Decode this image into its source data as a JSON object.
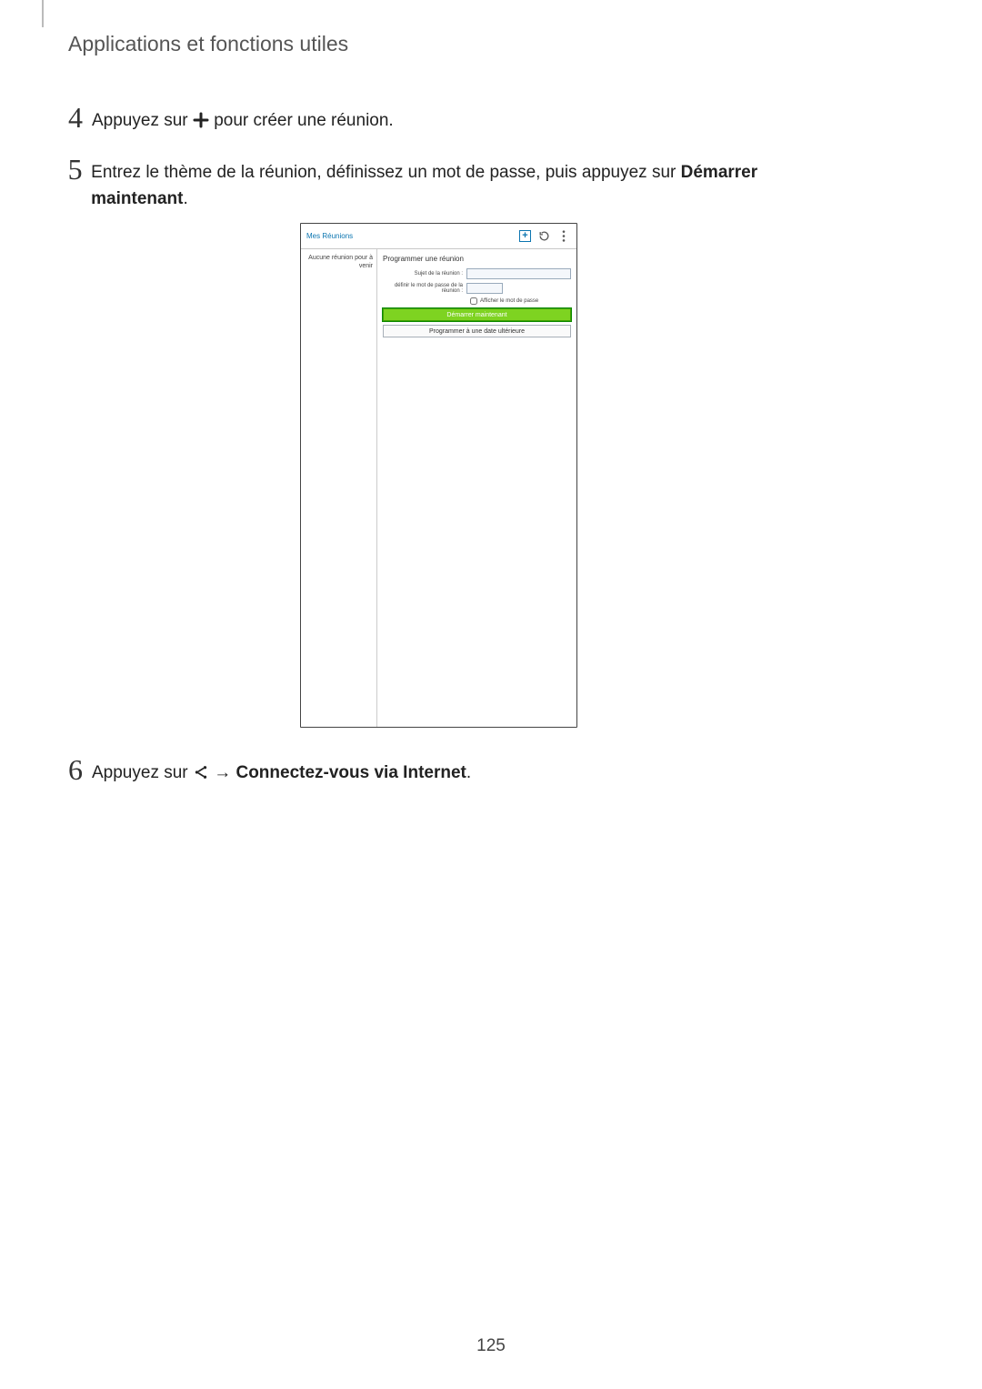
{
  "header": {
    "title": "Applications et fonctions utiles"
  },
  "steps": {
    "s4": {
      "num": "4",
      "prefix": "Appuyez sur ",
      "suffix": " pour créer une réunion."
    },
    "s5": {
      "num": "5",
      "text_a": "Entrez le thème de la réunion, définissez un mot de passe, puis appuyez sur ",
      "bold": "Démarrer maintenant",
      "text_b": "."
    },
    "s6": {
      "num": "6",
      "prefix": "Appuyez sur ",
      "arrow": " → ",
      "bold": "Connectez-vous via Internet",
      "suffix": "."
    }
  },
  "device": {
    "appbar_title": "Mes Réunions",
    "sidebar_text": "Aucune réunion pour à venir",
    "panel_title": "Programmer une réunion",
    "subject_label": "Sujet de la réunion :",
    "password_label": "définir le mot de passe de la réunion :",
    "show_password": "Afficher le mot de passe",
    "btn_start": "Démarrer maintenant",
    "btn_schedule": "Programmer à une date ultérieure"
  },
  "page_number": "125"
}
